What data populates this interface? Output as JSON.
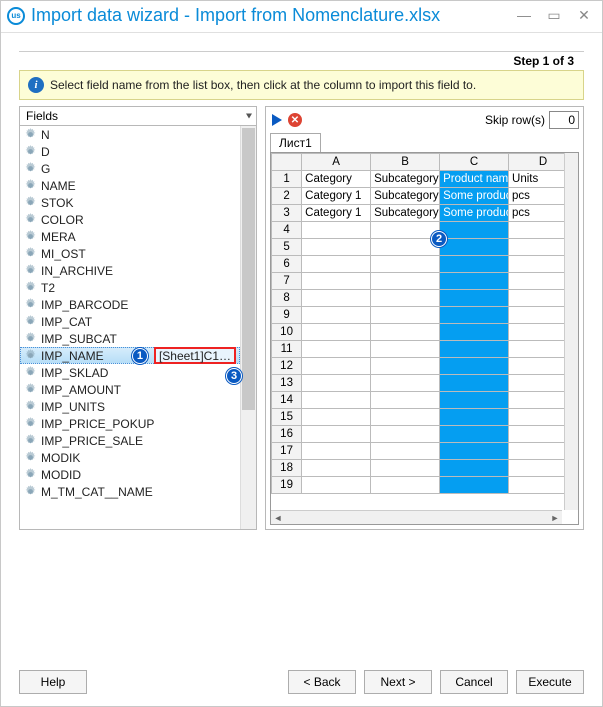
{
  "window": {
    "title": "Import data wizard - Import from Nomenclature.xlsx"
  },
  "step_label": "Step 1 of 3",
  "info_text": "Select field name from the list box, then click at the column to import this field to.",
  "fields_header": "Fields",
  "fields": [
    {
      "name": "N"
    },
    {
      "name": "D"
    },
    {
      "name": "G"
    },
    {
      "name": "NAME"
    },
    {
      "name": "STOK"
    },
    {
      "name": "COLOR"
    },
    {
      "name": "MERA"
    },
    {
      "name": "MI_OST"
    },
    {
      "name": "IN_ARCHIVE"
    },
    {
      "name": "T2"
    },
    {
      "name": "IMP_BARCODE"
    },
    {
      "name": "IMP_CAT"
    },
    {
      "name": "IMP_SUBCAT"
    },
    {
      "name": "IMP_NAME",
      "mapping": "[Sheet1]C1…",
      "selected": true
    },
    {
      "name": "IMP_SKLAD"
    },
    {
      "name": "IMP_AMOUNT"
    },
    {
      "name": "IMP_UNITS"
    },
    {
      "name": "IMP_PRICE_POKUP"
    },
    {
      "name": "IMP_PRICE_SALE"
    },
    {
      "name": "MODIK"
    },
    {
      "name": "MODID"
    },
    {
      "name": "M_TM_CAT__NAME"
    }
  ],
  "skip_rows": {
    "label": "Skip row(s)",
    "value": "0"
  },
  "sheet_tab": "Лист1",
  "grid": {
    "col_headers": [
      "",
      "A",
      "B",
      "C",
      "D"
    ],
    "selected_col": 3,
    "rows": [
      {
        "num": "1",
        "cells": [
          "Category",
          "Subcategory",
          "Product name",
          "Units"
        ]
      },
      {
        "num": "2",
        "cells": [
          "Category 1",
          "Subcategory",
          "Some product",
          "pcs"
        ]
      },
      {
        "num": "3",
        "cells": [
          "Category 1",
          "Subcategory",
          "Some product",
          "pcs"
        ]
      },
      {
        "num": "4",
        "cells": [
          "",
          "",
          "",
          ""
        ]
      },
      {
        "num": "5",
        "cells": [
          "",
          "",
          "",
          ""
        ]
      },
      {
        "num": "6",
        "cells": [
          "",
          "",
          "",
          ""
        ]
      },
      {
        "num": "7",
        "cells": [
          "",
          "",
          "",
          ""
        ]
      },
      {
        "num": "8",
        "cells": [
          "",
          "",
          "",
          ""
        ]
      },
      {
        "num": "9",
        "cells": [
          "",
          "",
          "",
          ""
        ]
      },
      {
        "num": "10",
        "cells": [
          "",
          "",
          "",
          ""
        ]
      },
      {
        "num": "11",
        "cells": [
          "",
          "",
          "",
          ""
        ]
      },
      {
        "num": "12",
        "cells": [
          "",
          "",
          "",
          ""
        ]
      },
      {
        "num": "13",
        "cells": [
          "",
          "",
          "",
          ""
        ]
      },
      {
        "num": "14",
        "cells": [
          "",
          "",
          "",
          ""
        ]
      },
      {
        "num": "15",
        "cells": [
          "",
          "",
          "",
          ""
        ]
      },
      {
        "num": "16",
        "cells": [
          "",
          "",
          "",
          ""
        ]
      },
      {
        "num": "17",
        "cells": [
          "",
          "",
          "",
          ""
        ]
      },
      {
        "num": "18",
        "cells": [
          "",
          "",
          "",
          ""
        ]
      },
      {
        "num": "19",
        "cells": [
          "",
          "",
          "",
          ""
        ]
      }
    ]
  },
  "buttons": {
    "help": "Help",
    "back": "< Back",
    "next": "Next >",
    "cancel": "Cancel",
    "execute": "Execute"
  },
  "callouts": {
    "one": "1",
    "two": "2",
    "three": "3"
  }
}
